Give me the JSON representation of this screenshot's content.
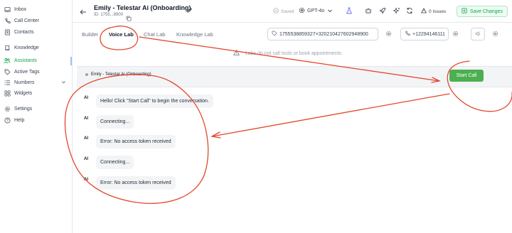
{
  "sidebar": {
    "items": [
      {
        "label": "Inbox",
        "icon": "inbox-icon"
      },
      {
        "label": "Call Center",
        "icon": "phone-icon"
      },
      {
        "label": "Contacts",
        "icon": "contacts-icon"
      },
      {
        "label": "Knowledge",
        "icon": "book-icon"
      },
      {
        "label": "Assistants",
        "icon": "users-icon"
      },
      {
        "label": "Active Tags",
        "icon": "tag-icon"
      },
      {
        "label": "Numbers",
        "icon": "list-icon"
      },
      {
        "label": "Widgets",
        "icon": "grid-icon"
      },
      {
        "label": "Settings",
        "icon": "gear-icon"
      },
      {
        "label": "Help",
        "icon": "help-icon"
      }
    ]
  },
  "header": {
    "title": "Emily - Telestar Ai (Onboarding)",
    "id_text": "ID: 1755...8900",
    "saved": "Saved",
    "model": "GPT-4o",
    "issues": "0 Issues",
    "save_changes": "Save Changes"
  },
  "tabs": [
    {
      "label": "Builder"
    },
    {
      "label": "Voice Lab"
    },
    {
      "label": "Chat Lab"
    },
    {
      "label": "Knowledge Lab"
    }
  ],
  "toolbar": {
    "session_id": "1755538859327×320210427602948900",
    "phone": "+12294146111"
  },
  "notice": "Labs do not call tools or book appointments",
  "callbar": {
    "assistant_name": "Emily - Telestar Ai (Onboarding)",
    "start_call": "Start Call"
  },
  "messages": [
    {
      "sender": "AI",
      "text": "Hello! Click \"Start Call\" to begin the conversation."
    },
    {
      "sender": "AI",
      "text": "Connecting..."
    },
    {
      "sender": "AI",
      "text": "Error: No access token received"
    },
    {
      "sender": "AI",
      "text": "Connecting..."
    },
    {
      "sender": "AI",
      "text": "Error: No access token received"
    }
  ],
  "colors": {
    "accent_green": "#4caf50",
    "annotation_red": "#e3472b"
  }
}
